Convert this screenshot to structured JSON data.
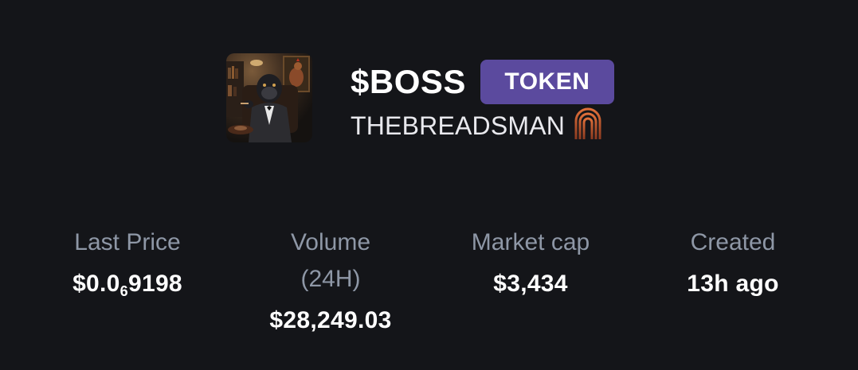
{
  "token": {
    "ticker": "$BOSS",
    "badge": "TOKEN",
    "creator": "THEBREADSMAN",
    "badge_color": "#5b4a9e"
  },
  "stats": {
    "last_price": {
      "label": "Last Price",
      "prefix": "$0.0",
      "subscript": "6",
      "suffix": "9198"
    },
    "volume": {
      "label_line1": "Volume",
      "label_line2": "(24H)",
      "value": "$28,249.03"
    },
    "market_cap": {
      "label": "Market cap",
      "value": "$3,434"
    },
    "created": {
      "label": "Created",
      "value": "13h ago"
    }
  },
  "icons": {
    "avatar": "gorilla-boss-avatar",
    "creator_badge": "arch-icon"
  }
}
